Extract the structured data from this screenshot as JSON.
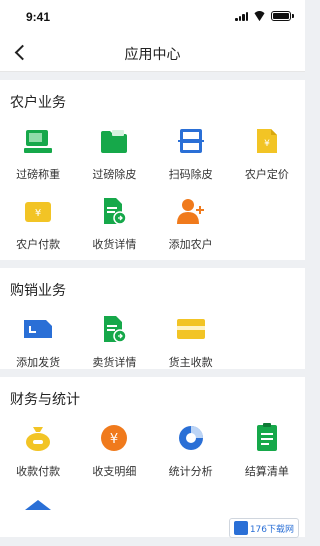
{
  "status_bar": {
    "time": "9:41"
  },
  "nav": {
    "title": "应用中心"
  },
  "colors": {
    "green": "#16a84a",
    "blue": "#2a6fd6",
    "yellow": "#f2c425",
    "orange": "#f07a1c"
  },
  "sections": [
    {
      "title": "农户业务",
      "items": [
        {
          "label": "过磅称重",
          "icon": "scale-icon"
        },
        {
          "label": "过磅除皮",
          "icon": "folder-icon"
        },
        {
          "label": "扫码除皮",
          "icon": "scan-icon"
        },
        {
          "label": "农户定价",
          "icon": "price-tag-icon"
        },
        {
          "label": "农户付款",
          "icon": "payment-icon"
        },
        {
          "label": "收货详情",
          "icon": "receipt-doc-icon"
        },
        {
          "label": "添加农户",
          "icon": "add-user-icon"
        }
      ]
    },
    {
      "title": "购销业务",
      "items": [
        {
          "label": "添加发货",
          "icon": "add-shipment-icon"
        },
        {
          "label": "卖货详情",
          "icon": "sales-doc-icon"
        },
        {
          "label": "货主收款",
          "icon": "wallet-icon"
        }
      ]
    },
    {
      "title": "财务与统计",
      "items": [
        {
          "label": "收款付款",
          "icon": "money-bag-icon"
        },
        {
          "label": "收支明细",
          "icon": "yen-coin-icon"
        },
        {
          "label": "统计分析",
          "icon": "pie-chart-icon"
        },
        {
          "label": "结算清单",
          "icon": "checklist-icon"
        }
      ]
    }
  ],
  "watermark": {
    "text": "176下载网"
  }
}
